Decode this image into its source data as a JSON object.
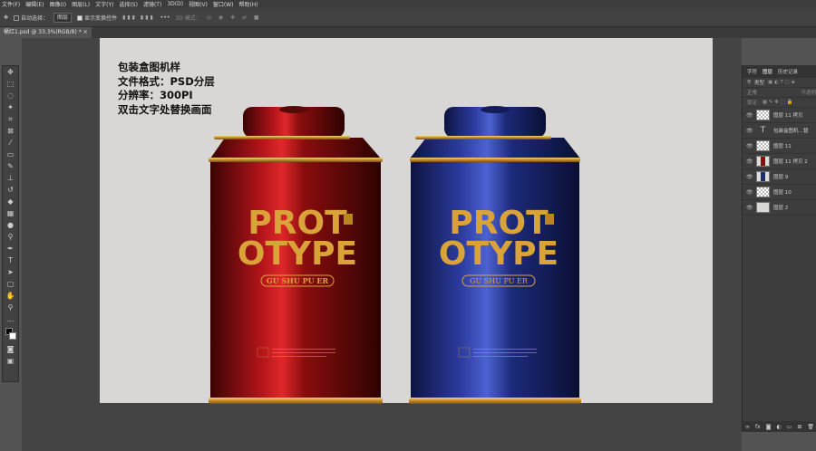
{
  "menu": [
    "文件(F)",
    "编辑(E)",
    "图像(I)",
    "图层(L)",
    "文字(Y)",
    "选择(S)",
    "滤镜(T)",
    "3D(D)",
    "视图(V)",
    "窗口(W)",
    "帮助(H)"
  ],
  "options": {
    "auto_select_label": "自动选择：",
    "layer_select": "图层",
    "show_transform_label": "显示变换控件",
    "mode_3d": "3D 模式："
  },
  "doc_tab": "桶红1.psd @ 33.3%(RGB/8) *",
  "doc_lines": [
    "包装盒图机样",
    "文件格式：PSD分层",
    "分辨率：300PI",
    "双击文字处替换画面"
  ],
  "cans": {
    "title_1": "PROT",
    "title_2": "OTYPE",
    "sub": "GU SHU PU ER",
    "red_color": "#8a0d0d",
    "blue_color": "#1c2a7a",
    "gold": "#d9a33a"
  },
  "panel": {
    "tabs": [
      "字符",
      "图层",
      "历史记录"
    ],
    "kind": "类型",
    "blend": "正常",
    "opacity": "不透明",
    "lock": "锁定:",
    "layers": [
      {
        "name": "图层 11 拷贝",
        "kind": "smart"
      },
      {
        "name": "包装盒图机…替",
        "kind": "text"
      },
      {
        "name": "图层 11",
        "kind": "smart"
      },
      {
        "name": "图层 11 拷贝 2",
        "kind": "red"
      },
      {
        "name": "图层 9",
        "kind": "blue"
      },
      {
        "name": "图层 10",
        "kind": "trans"
      },
      {
        "name": "图层 2",
        "kind": "plain"
      }
    ]
  }
}
